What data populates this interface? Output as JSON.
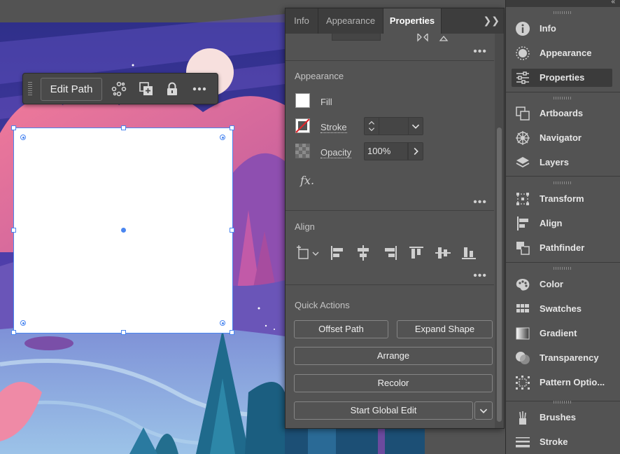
{
  "taskbar": {
    "edit_path_label": "Edit Path",
    "icons": [
      "distribute-icon",
      "duplicate-icon",
      "lock-icon",
      "more-icon"
    ]
  },
  "panel": {
    "tabs": [
      {
        "label": "Info",
        "active": false
      },
      {
        "label": "Appearance",
        "active": false
      },
      {
        "label": "Properties",
        "active": true
      }
    ],
    "appearance": {
      "title": "Appearance",
      "fill_label": "Fill",
      "fill_color": "#ffffff",
      "stroke_label": "Stroke",
      "stroke_weight": "",
      "opacity_label": "Opacity",
      "opacity_value": "100%",
      "fx_label": "fx."
    },
    "align": {
      "title": "Align",
      "icons": [
        "align-to-icon",
        "align-left-icon",
        "align-horizontal-center-icon",
        "align-right-icon",
        "align-top-icon",
        "align-vertical-center-icon",
        "align-bottom-icon"
      ]
    },
    "quick_actions": {
      "title": "Quick Actions",
      "offset_path": "Offset Path",
      "expand_shape": "Expand Shape",
      "arrange": "Arrange",
      "recolor": "Recolor",
      "start_global_edit": "Start Global Edit"
    }
  },
  "dock": {
    "groups": [
      {
        "items": [
          {
            "label": "Info",
            "icon": "info-icon"
          },
          {
            "label": "Appearance",
            "icon": "appearance-icon"
          },
          {
            "label": "Properties",
            "icon": "properties-icon",
            "active": true
          }
        ]
      },
      {
        "items": [
          {
            "label": "Artboards",
            "icon": "artboards-icon"
          },
          {
            "label": "Navigator",
            "icon": "navigator-icon"
          },
          {
            "label": "Layers",
            "icon": "layers-icon"
          }
        ]
      },
      {
        "items": [
          {
            "label": "Transform",
            "icon": "transform-icon"
          },
          {
            "label": "Align",
            "icon": "align-icon"
          },
          {
            "label": "Pathfinder",
            "icon": "pathfinder-icon"
          }
        ]
      },
      {
        "items": [
          {
            "label": "Color",
            "icon": "color-icon"
          },
          {
            "label": "Swatches",
            "icon": "swatches-icon"
          },
          {
            "label": "Gradient",
            "icon": "gradient-icon"
          },
          {
            "label": "Transparency",
            "icon": "transparency-icon"
          },
          {
            "label": "Pattern Optio...",
            "icon": "pattern-options-icon"
          }
        ]
      },
      {
        "items": [
          {
            "label": "Brushes",
            "icon": "brushes-icon"
          },
          {
            "label": "Stroke",
            "icon": "stroke-icon"
          }
        ]
      }
    ]
  },
  "colors": {
    "selection": "#4a86f0",
    "panel_bg": "#535353",
    "tab_bar": "#3d3d3d"
  }
}
